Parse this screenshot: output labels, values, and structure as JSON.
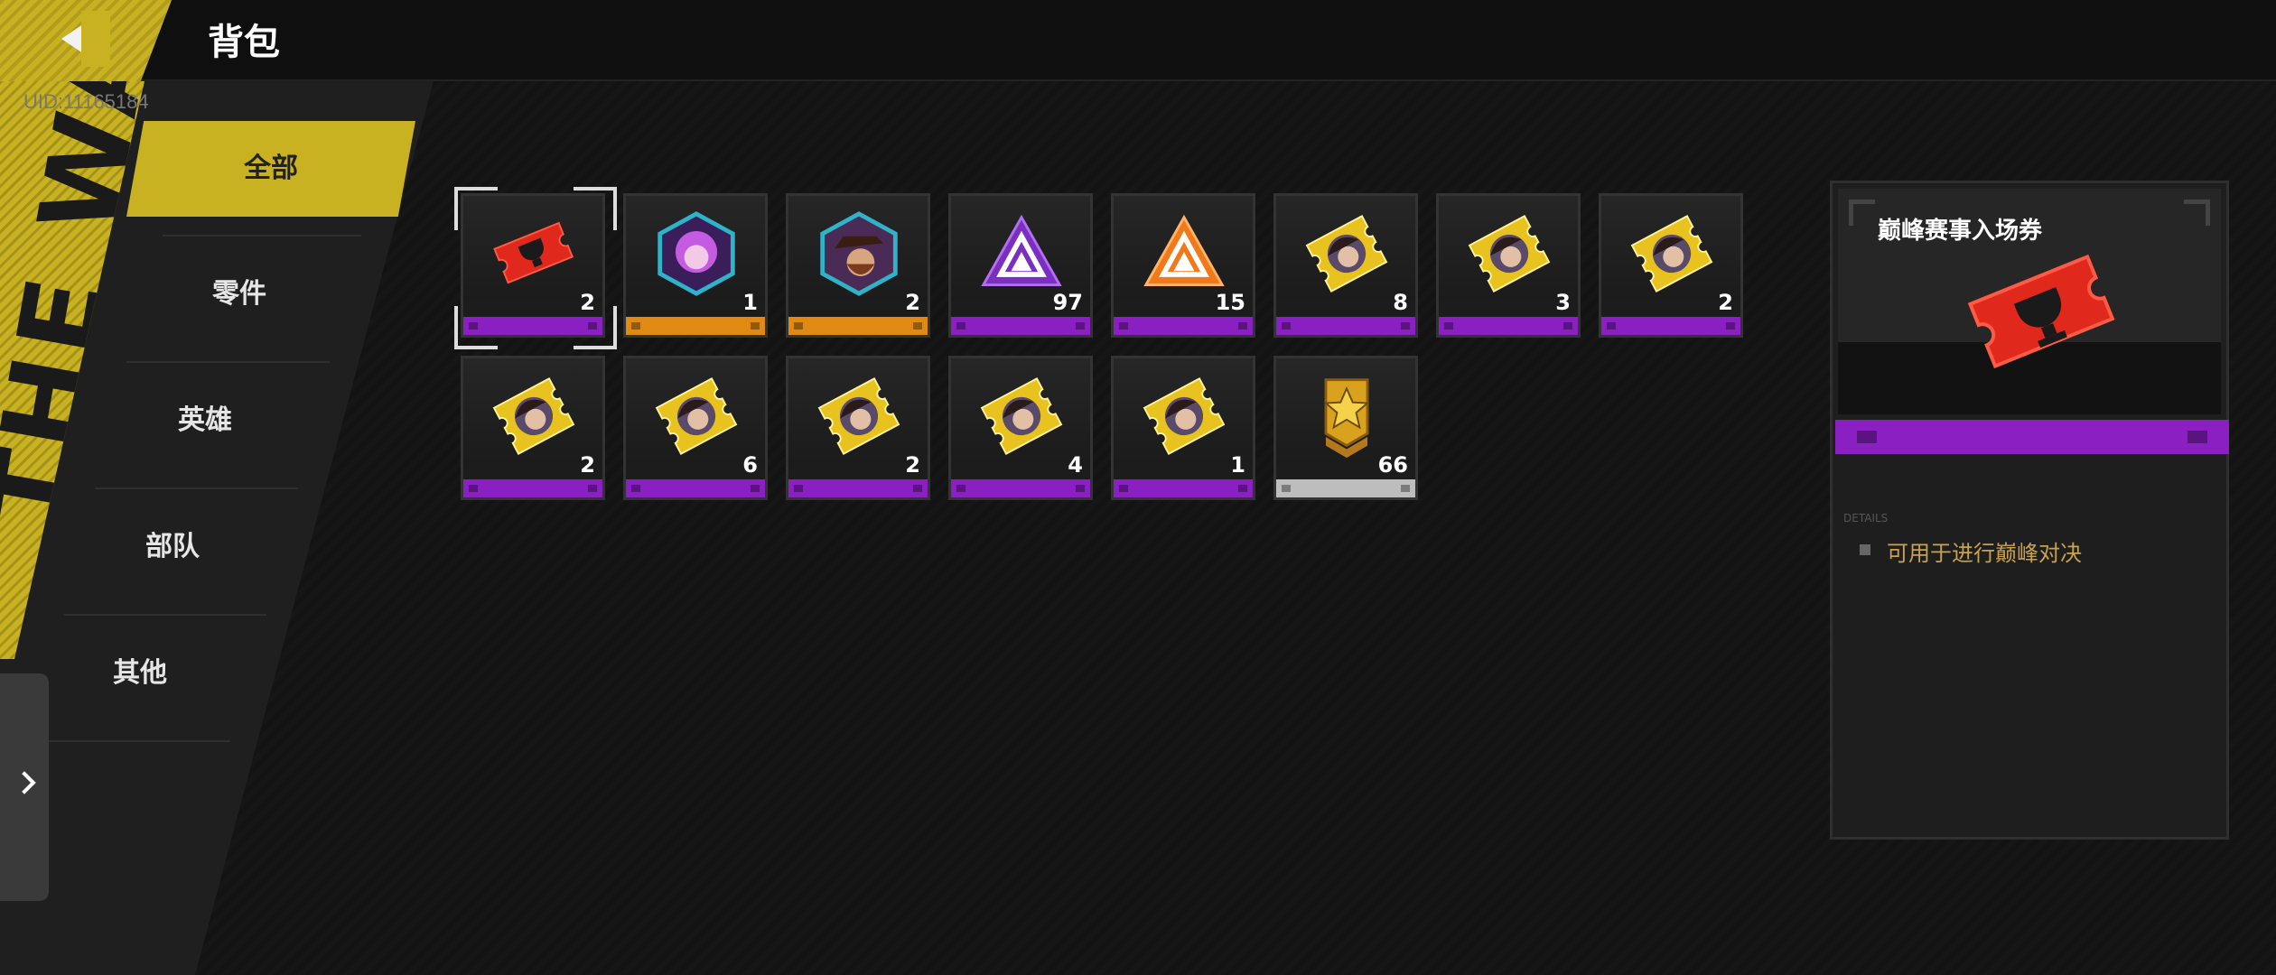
{
  "header": {
    "title": "背包",
    "uid": "UID:11165184"
  },
  "sidebar": {
    "stripe_text": "THE WAR",
    "tabs": [
      {
        "label": "全部",
        "active": true
      },
      {
        "label": "零件"
      },
      {
        "label": "英雄"
      },
      {
        "label": "部队"
      },
      {
        "label": "其他"
      }
    ]
  },
  "items": [
    {
      "name": "巅峰赛事入场券",
      "count": "2",
      "rarity": "purple",
      "icon": "red-ticket-icon",
      "selected": true
    },
    {
      "name": "hero-token-pink",
      "count": "1",
      "rarity": "orange",
      "icon": "hero-hex-pink-icon"
    },
    {
      "name": "hero-token-hat",
      "count": "2",
      "rarity": "orange",
      "icon": "hero-hex-hat-icon"
    },
    {
      "name": "purple-triangle",
      "count": "97",
      "rarity": "purple",
      "icon": "purple-triangle-icon"
    },
    {
      "name": "orange-triangle",
      "count": "15",
      "rarity": "purple",
      "icon": "orange-triangle-icon"
    },
    {
      "name": "hero-ticket-1",
      "count": "8",
      "rarity": "purple",
      "icon": "hero-ticket-icon"
    },
    {
      "name": "hero-ticket-2",
      "count": "3",
      "rarity": "purple",
      "icon": "hero-ticket-icon"
    },
    {
      "name": "hero-ticket-3",
      "count": "2",
      "rarity": "purple",
      "icon": "hero-ticket-icon"
    },
    {
      "name": "hero-ticket-4",
      "count": "2",
      "rarity": "purple",
      "icon": "hero-ticket-icon"
    },
    {
      "name": "hero-ticket-5",
      "count": "6",
      "rarity": "purple",
      "icon": "hero-ticket-icon"
    },
    {
      "name": "hero-ticket-6",
      "count": "2",
      "rarity": "purple",
      "icon": "hero-ticket-icon"
    },
    {
      "name": "hero-ticket-7",
      "count": "4",
      "rarity": "purple",
      "icon": "hero-ticket-icon"
    },
    {
      "name": "hero-ticket-8",
      "count": "1",
      "rarity": "purple",
      "icon": "hero-ticket-icon"
    },
    {
      "name": "star-badge",
      "count": "66",
      "rarity": "grey",
      "icon": "star-badge-icon"
    }
  ],
  "detail": {
    "name": "巅峰赛事入场券",
    "details_label": "DETAILS",
    "description": "可用于进行巅峰对决"
  },
  "colors": {
    "accent": "#c9b221",
    "purple": "#8a1fc2",
    "orange": "#e08a14",
    "grey": "#bdbdbd"
  }
}
